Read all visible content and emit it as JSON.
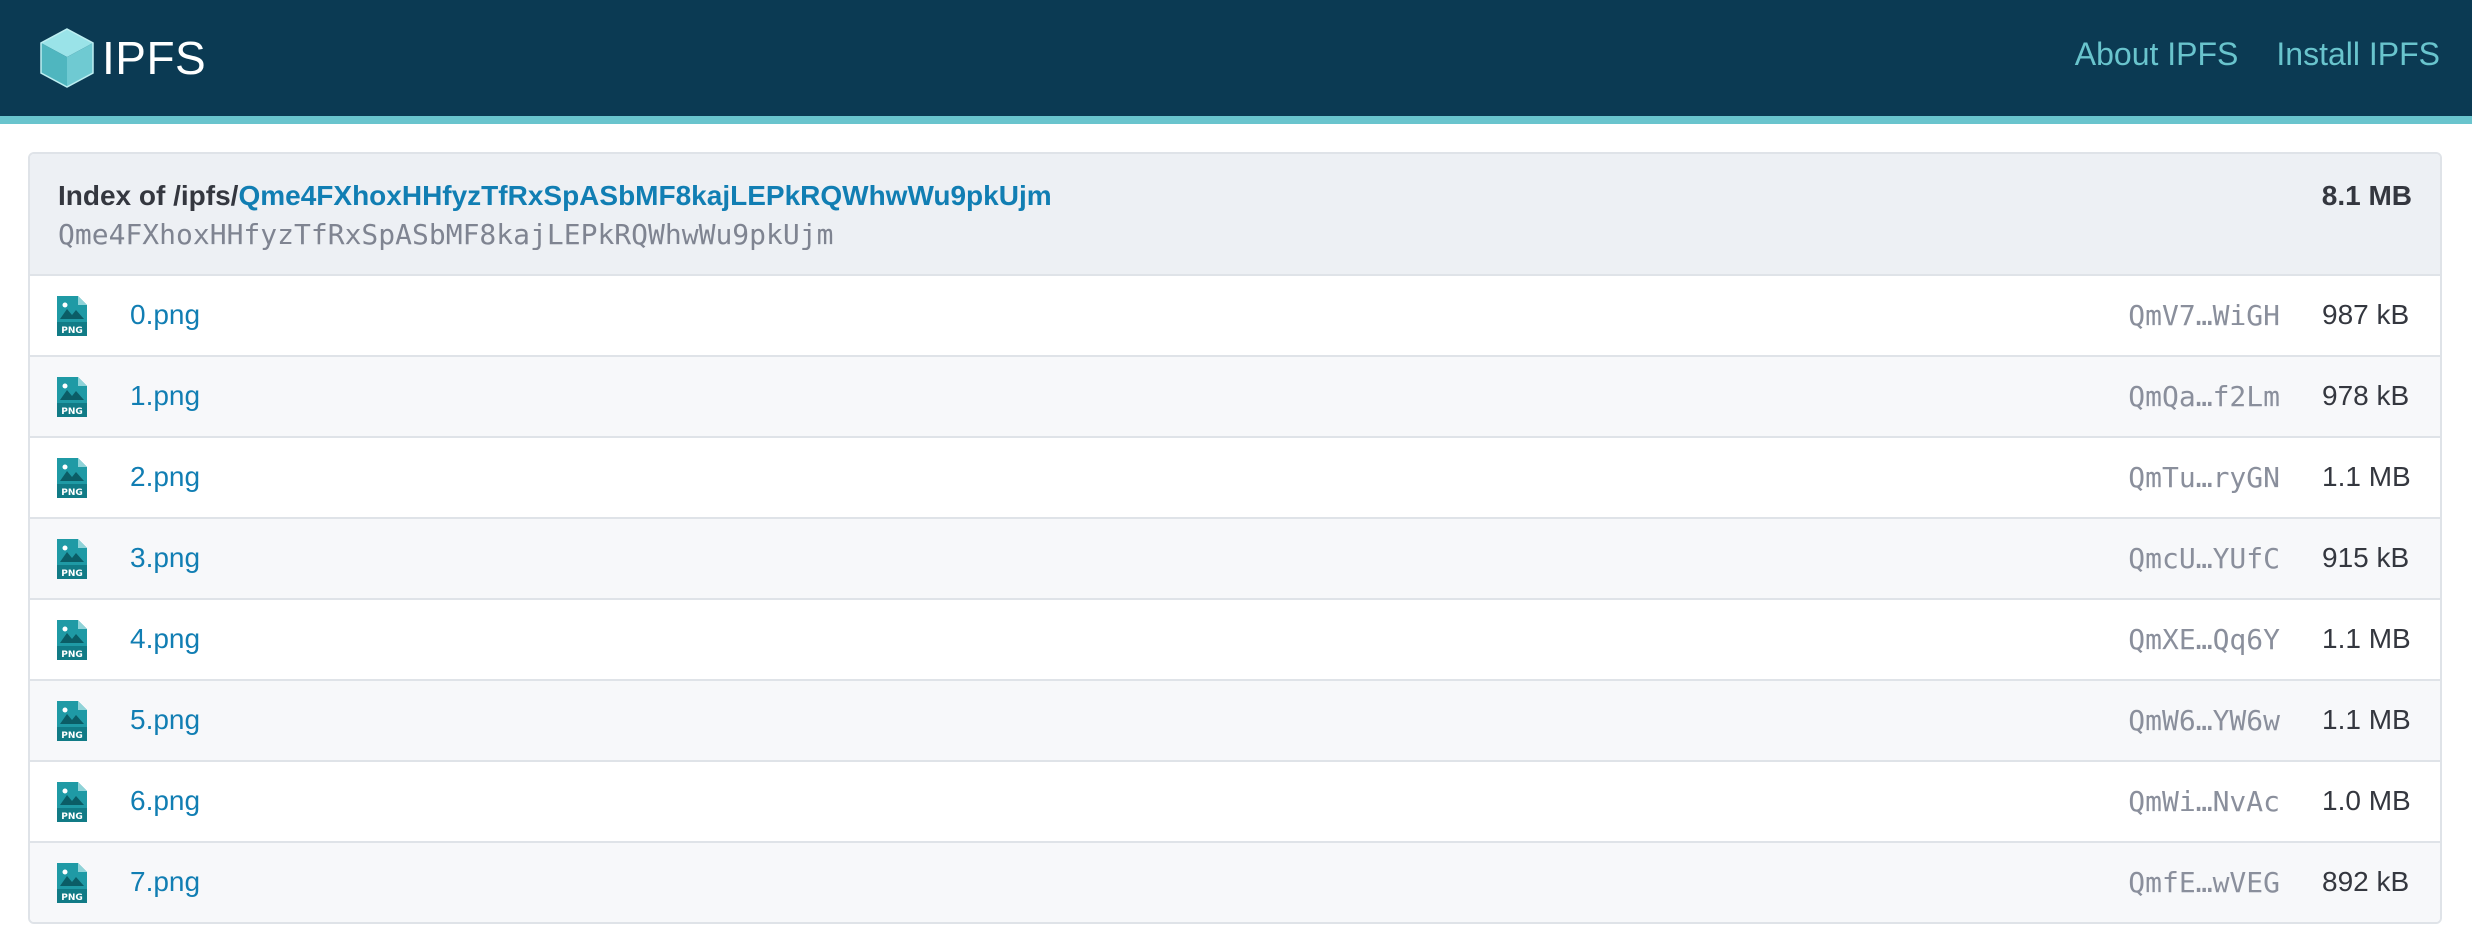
{
  "header": {
    "brand": "IPFS",
    "logo_icon": "ipfs-cube-icon",
    "nav": [
      {
        "label": "About IPFS"
      },
      {
        "label": "Install IPFS"
      }
    ],
    "colors": {
      "bar": "#0b3a53",
      "accent": "#69c4cd"
    }
  },
  "listing": {
    "index_prefix": "Index of /ipfs/",
    "cid": "Qme4FXhoxHHfyzTfRxSpASbMF8kajLEPkRQWhwWu9pkUjm",
    "cid_plain": "Qme4FXhoxHHfyzTfRxSpASbMF8kajLEPkRQWhwWu9pkUjm",
    "total_size": "8.1 MB",
    "files": [
      {
        "name": "0.png",
        "hash": "QmV7…WiGH",
        "size": "987 kB",
        "icon": "png-file-icon"
      },
      {
        "name": "1.png",
        "hash": "QmQa…f2Lm",
        "size": "978 kB",
        "icon": "png-file-icon"
      },
      {
        "name": "2.png",
        "hash": "QmTu…ryGN",
        "size": "1.1 MB",
        "icon": "png-file-icon"
      },
      {
        "name": "3.png",
        "hash": "QmcU…YUfC",
        "size": "915 kB",
        "icon": "png-file-icon"
      },
      {
        "name": "4.png",
        "hash": "QmXE…Qq6Y",
        "size": "1.1 MB",
        "icon": "png-file-icon"
      },
      {
        "name": "5.png",
        "hash": "QmW6…YW6w",
        "size": "1.1 MB",
        "icon": "png-file-icon"
      },
      {
        "name": "6.png",
        "hash": "QmWi…NvAc",
        "size": "1.0 MB",
        "icon": "png-file-icon"
      },
      {
        "name": "7.png",
        "hash": "QmfE…wVEG",
        "size": "892 kB",
        "icon": "png-file-icon"
      }
    ],
    "icon_label": "PNG"
  }
}
